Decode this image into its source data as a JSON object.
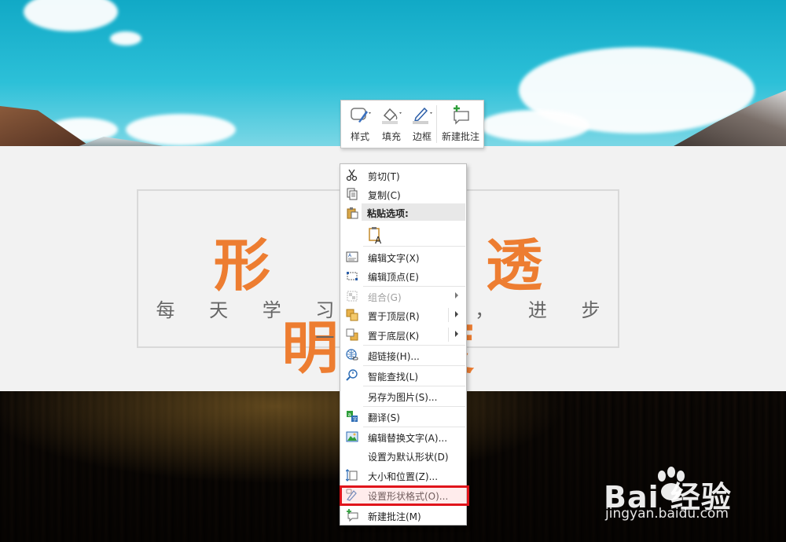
{
  "slide": {
    "title": "形 状 透 明 度",
    "subtitle": "每 天 学 习 一 点 ， 进 步 一 点 。"
  },
  "mini_toolbar": {
    "buttons": [
      {
        "label": "样式",
        "icon": "shape-style-icon"
      },
      {
        "label": "填充",
        "icon": "paint-bucket-icon"
      },
      {
        "label": "边框",
        "icon": "pen-outline-icon"
      },
      {
        "label": "新建批注",
        "icon": "new-comment-icon"
      }
    ]
  },
  "context_menu": {
    "items": [
      {
        "label": "剪切(T)",
        "icon": "scissors-icon"
      },
      {
        "label": "复制(C)",
        "icon": "copy-icon"
      },
      {
        "label": "粘贴选项:",
        "icon": "paste-icon"
      },
      {
        "label": "编辑文字(X)",
        "icon": "edit-text-icon"
      },
      {
        "label": "编辑顶点(E)",
        "icon": "edit-points-icon"
      },
      {
        "label": "组合(G)",
        "icon": "group-icon",
        "disabled": true
      },
      {
        "label": "置于顶层(R)",
        "icon": "bring-to-front-icon"
      },
      {
        "label": "置于底层(K)",
        "icon": "send-to-back-icon"
      },
      {
        "label": "超链接(H)...",
        "icon": "hyperlink-icon"
      },
      {
        "label": "智能查找(L)",
        "icon": "smart-lookup-icon"
      },
      {
        "label": "另存为图片(S)...",
        "icon": ""
      },
      {
        "label": "翻译(S)",
        "icon": "translate-icon"
      },
      {
        "label": "编辑替换文字(A)...",
        "icon": "alt-text-icon"
      },
      {
        "label": "设置为默认形状(D)",
        "icon": ""
      },
      {
        "label": "大小和位置(Z)...",
        "icon": "size-position-icon"
      },
      {
        "label": "设置形状格式(O)...",
        "icon": "format-shape-icon",
        "highlighted": true
      },
      {
        "label": "新建批注(M)",
        "icon": "new-comment-icon"
      }
    ]
  },
  "watermark": {
    "brand": "Bai 经验",
    "url": "jingyan.baidu.com"
  },
  "colors": {
    "title_orange": "#ed7d31",
    "highlight_red": "#e0141b"
  }
}
